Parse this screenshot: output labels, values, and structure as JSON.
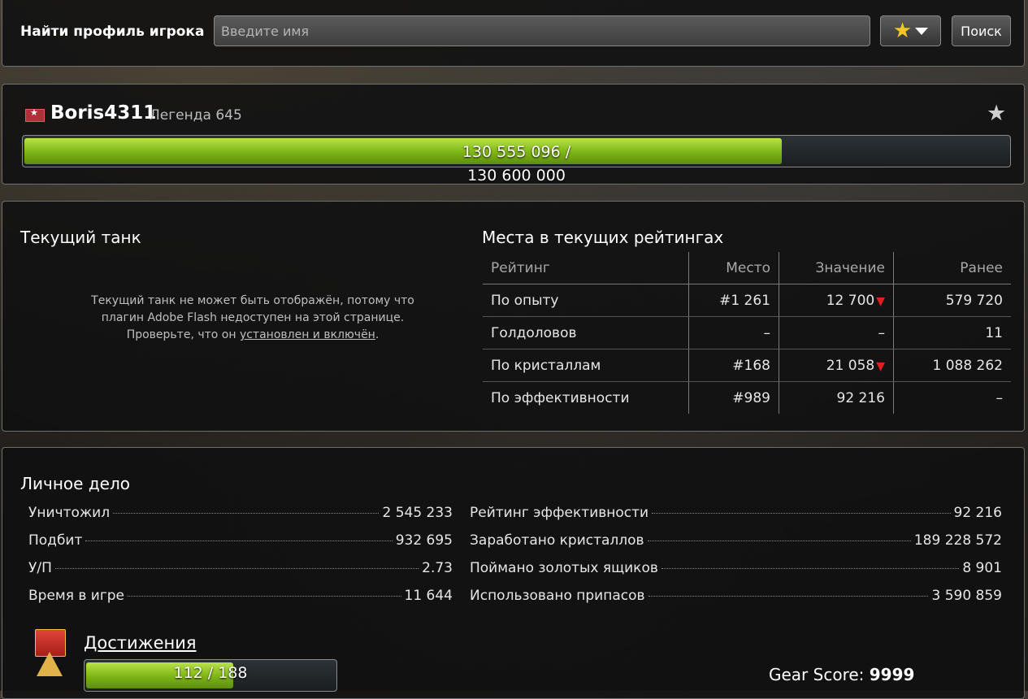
{
  "search": {
    "label": "Найти профиль игрока",
    "placeholder": "Введите имя",
    "button": "Поиск"
  },
  "profile": {
    "name": "Boris4311",
    "rank": "Легенда 645",
    "xp_current": "130 555 096 /",
    "xp_max": "130 600 000",
    "xp_fill_fraction": 0.77
  },
  "tank": {
    "title": "Текущий танк",
    "message_part1": "Текущий танк не может быть отображён, потому что плагин Adobe Flash недоступен на этой странице. Проверьте, что он ",
    "message_link": "установлен и включён",
    "message_end": "."
  },
  "ratings": {
    "title": "Места в текущих рейтингах",
    "headers": [
      "Рейтинг",
      "Место",
      "Значение",
      "Ранее"
    ],
    "rows": [
      {
        "name": "По опыту",
        "place": "#1 261",
        "value": "12 700",
        "down": true,
        "before": "579 720"
      },
      {
        "name": "Голдоловов",
        "place": "–",
        "value": "–",
        "down": false,
        "before": "11"
      },
      {
        "name": "По кристаллам",
        "place": "#168",
        "value": "21 058",
        "down": true,
        "before": "1 088 262"
      },
      {
        "name": "По эффективности",
        "place": "#989",
        "value": "92 216",
        "down": false,
        "before": "–"
      }
    ]
  },
  "personal": {
    "title": "Личное дело",
    "left": [
      {
        "label": "Уничтожил",
        "value": "2 545 233"
      },
      {
        "label": "Подбит",
        "value": "932 695"
      },
      {
        "label": "У/П",
        "value": "2.73"
      },
      {
        "label": "Время в игре",
        "value": "11 644"
      }
    ],
    "right": [
      {
        "label": "Рейтинг эффективности",
        "value": "92 216"
      },
      {
        "label": "Заработано кристаллов",
        "value": "189 228 572"
      },
      {
        "label": "Поймано золотых ящиков",
        "value": "8 901"
      },
      {
        "label": "Использовано припасов",
        "value": "3 590 859"
      }
    ]
  },
  "achievements": {
    "title": "Достижения",
    "progress": "112 / 188",
    "fill_fraction": 0.59
  },
  "gear": {
    "label": "Gear Score:",
    "value": "9999"
  },
  "colors": {
    "accent_green": "#7db416",
    "down_arrow": "#e02020",
    "star_gold": "#f3c623"
  }
}
